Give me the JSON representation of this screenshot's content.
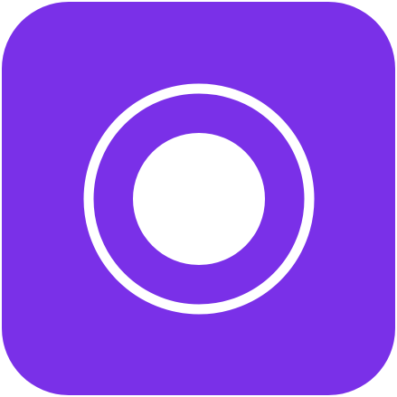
{
  "app_icon": {
    "icon": "record-icon",
    "background_color": "#7A30E8",
    "glyph_color": "#FFFFFF"
  }
}
